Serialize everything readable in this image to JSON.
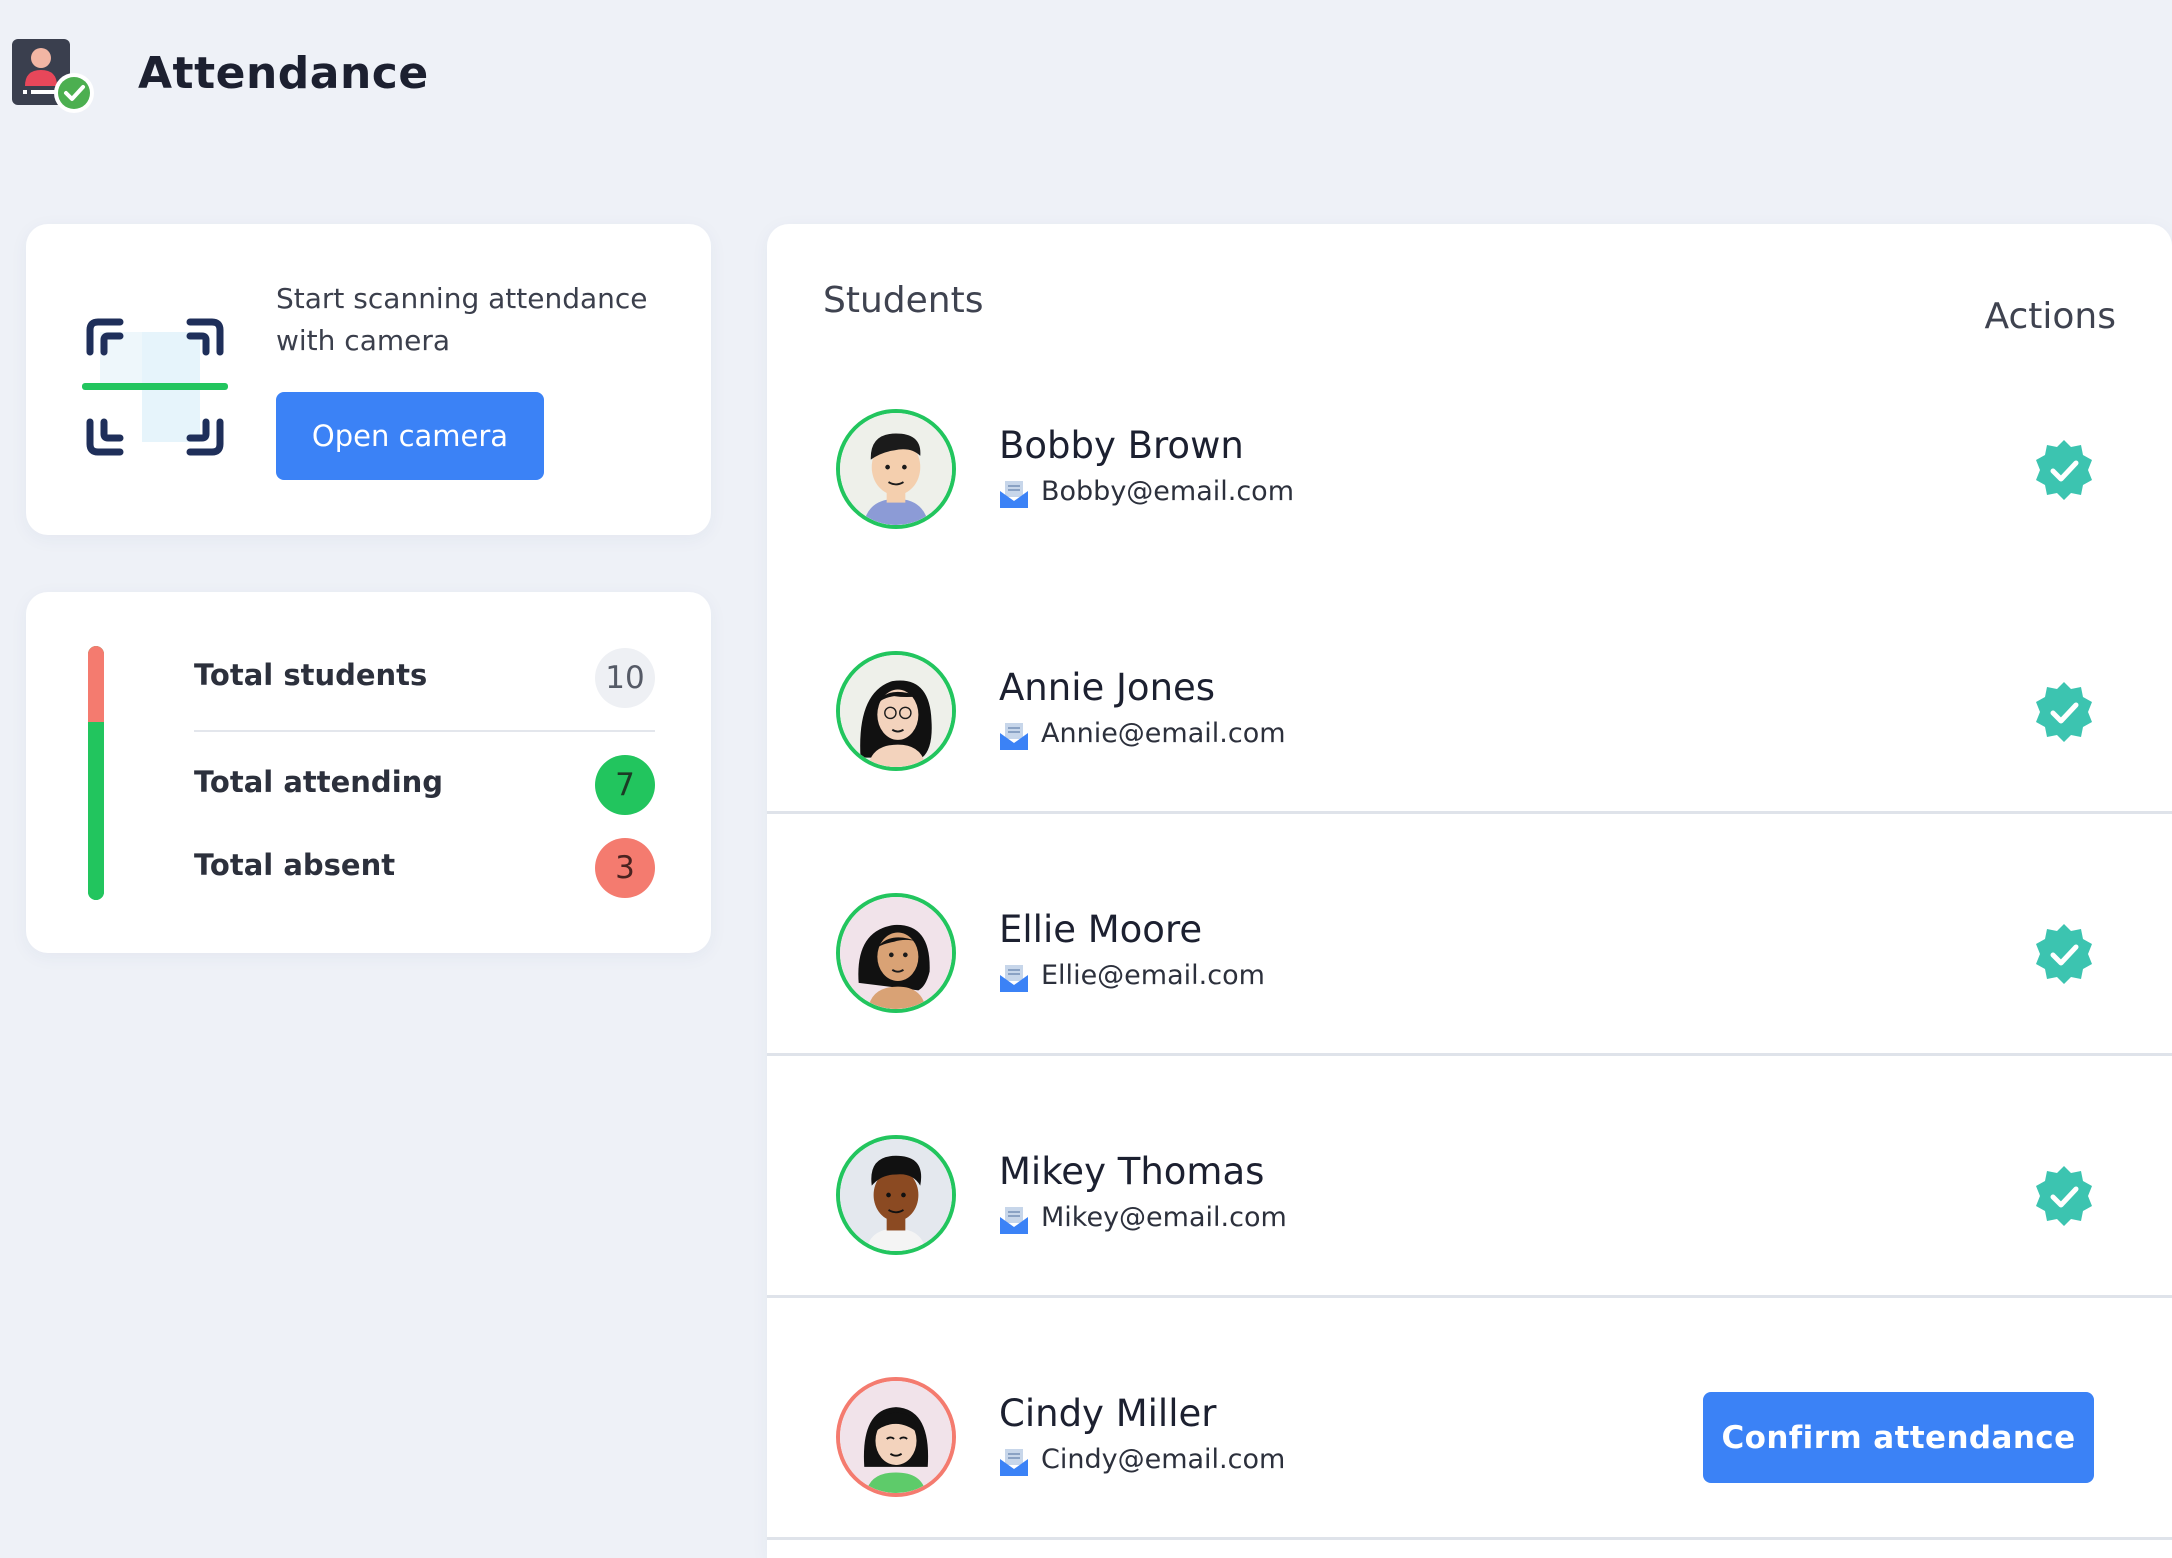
{
  "header": {
    "title": "Attendance",
    "logo_icon": "attendance-check-icon"
  },
  "scan": {
    "icon": "qr-scan-icon",
    "text": "Start scanning attendance with camera",
    "button_label": "Open camera"
  },
  "stats": {
    "total_label": "Total students",
    "total_value": "10",
    "attending_label": "Total attending",
    "attending_value": "7",
    "absent_label": "Total absent",
    "absent_value": "3",
    "attending_fraction": 0.7,
    "colors": {
      "attending": "#22c55e",
      "absent": "#f47b6f",
      "accent": "#3b82f6"
    }
  },
  "students": {
    "heading": "Students",
    "actions_heading": "Actions",
    "rows": [
      {
        "name": "Bobby Brown",
        "email": "Bobby@email.com",
        "status": "confirmed",
        "action_icon": "verified-check-icon"
      },
      {
        "name": "Annie Jones",
        "email": "Annie@email.com",
        "status": "confirmed",
        "action_icon": "verified-check-icon"
      },
      {
        "name": "Ellie Moore",
        "email": "Ellie@email.com",
        "status": "confirmed",
        "action_icon": "verified-check-icon"
      },
      {
        "name": "Mikey Thomas",
        "email": "Mikey@email.com",
        "status": "confirmed",
        "action_icon": "verified-check-icon"
      },
      {
        "name": "Cindy Miller",
        "email": "Cindy@email.com",
        "status": "pending",
        "action_label": "Confirm attendance"
      }
    ]
  }
}
